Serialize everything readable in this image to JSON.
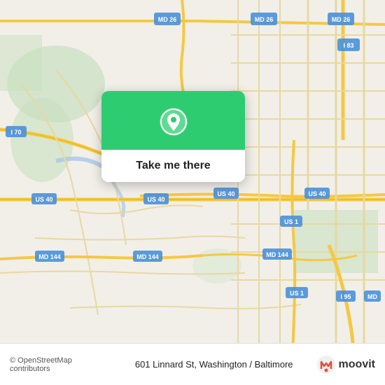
{
  "map": {
    "center_lat": 39.29,
    "center_lon": -76.67,
    "accent_color": "#2ecc71"
  },
  "popup": {
    "button_label": "Take me there"
  },
  "bottom_bar": {
    "copyright": "© OpenStreetMap contributors",
    "address": "601 Linnard St, Washington / Baltimore",
    "logo_alt": "moovit"
  },
  "road_labels": [
    "MD 26",
    "MD 26",
    "MD 26",
    "I 83",
    "I 70",
    "US 40",
    "US 40",
    "US 40",
    "US 40",
    "MD 144",
    "MD 144",
    "US 1",
    "MD 144",
    "US 1",
    "I 95",
    "MD"
  ]
}
